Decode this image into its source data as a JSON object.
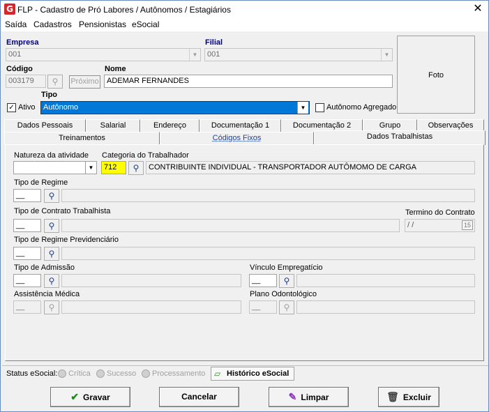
{
  "window": {
    "title": "FLP - Cadastro de Pró Labores / Autônomos / Estagiários",
    "logo_text": "G",
    "close_glyph": "✕"
  },
  "menu": {
    "items": [
      "Saída",
      "Cadastros",
      "Pensionistas",
      "eSocial"
    ]
  },
  "header": {
    "empresa_label": "Empresa",
    "empresa_value": "001",
    "filial_label": "Filial",
    "filial_value": "001",
    "codigo_label": "Código",
    "codigo_value": "003179",
    "proximo_label": "Próximo",
    "nome_label": "Nome",
    "nome_value": "ADEMAR FERNANDES",
    "tipo_label": "Tipo",
    "tipo_value": "Autônomo",
    "ativo_label": "Ativo",
    "ativo_checked": true,
    "agregado_label": "Autônomo Agregado",
    "agregado_checked": false,
    "foto_label": "Foto"
  },
  "tabs_row1": [
    "Dados Pessoais",
    "Salarial",
    "Endereço",
    "Documentação 1",
    "Documentação 2",
    "Grupo",
    "Observações"
  ],
  "tabs_row2": [
    "Treinamentos",
    "Códigos Fixos",
    "Dados Trabalhistas"
  ],
  "active_tab": "Dados Trabalhistas",
  "form": {
    "natureza_label": "Natureza da atividade",
    "natureza_value": "",
    "categoria_label": "Categoria do Trabalhador",
    "categoria_code": "712",
    "categoria_desc": "CONTRIBUINTE INDIVIDUAL - TRANSPORTADOR AUTÔMOMO DE CARGA",
    "regime_label": "Tipo de Regime",
    "regime_code": "__",
    "contrato_label": "Tipo de Contrato Trabalhista",
    "contrato_code": "__",
    "termino_label": "Termino do Contrato",
    "termino_value": "/ /",
    "previdenciario_label": "Tipo de Regime Previdenciário",
    "previdenciario_code": "__",
    "admissao_label": "Tipo de Admissão",
    "admissao_code": "__",
    "vinculo_label": "Vínculo Empregatício",
    "vinculo_code": "__",
    "assistencia_label": "Assistência Médica",
    "assistencia_code": "__",
    "odontologico_label": "Plano Odontológico",
    "odontologico_code": "__"
  },
  "status": {
    "label": "Status eSocial:",
    "options": [
      "Crítica",
      "Sucesso",
      "Processamento"
    ],
    "historico_label": "Histórico eSocial"
  },
  "footer": {
    "gravar": "Gravar",
    "cancelar": "Cancelar",
    "limpar": "Limpar",
    "excluir": "Excluir"
  },
  "colors": {
    "highlight_yellow": "#ffff00",
    "selection_blue": "#0078d7",
    "label_blue": "#00007f",
    "tab_blue_text": "#1f3f9f"
  }
}
